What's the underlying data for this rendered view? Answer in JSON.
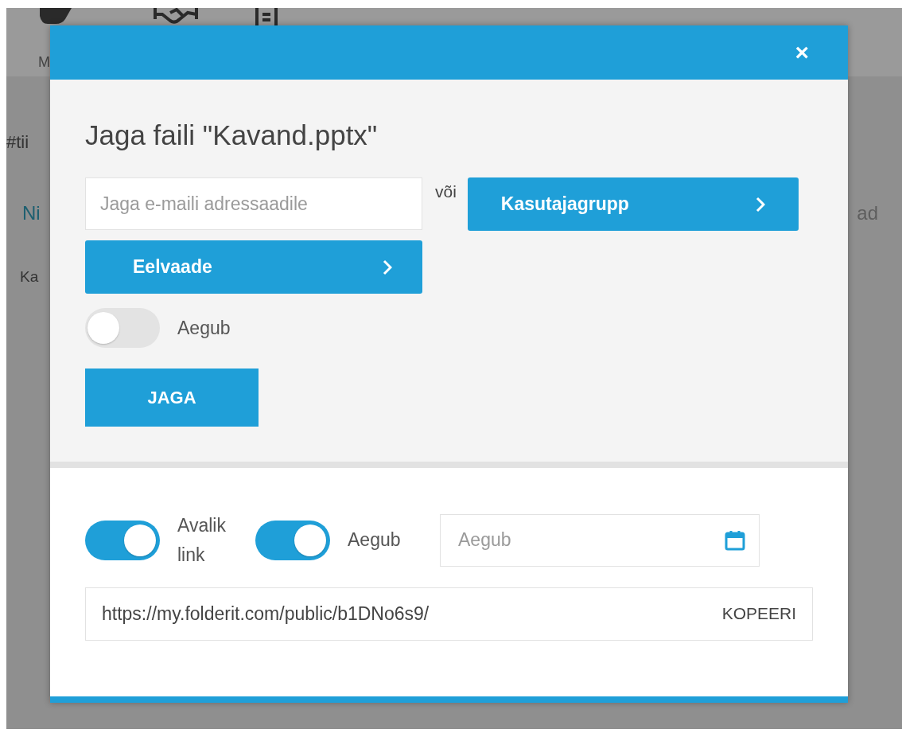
{
  "background": {
    "nav_label": "M",
    "tag": "#tii",
    "heading_left": "Ni",
    "heading_right": "ad",
    "row": "Ka"
  },
  "dialog": {
    "close": "×",
    "title": "Jaga faili \"Kavand.pptx\"",
    "email": {
      "placeholder": "Jaga e-maili adressaadile"
    },
    "or": "või",
    "group_button": "Kasutajagrupp",
    "preview_button": "Eelvaade",
    "expiry_toggle": {
      "label": "Aegub",
      "on": false
    },
    "share_button": "JAGA",
    "link_toggles": [
      {
        "label": "Avalik link",
        "on": true
      },
      {
        "label": "Aegub",
        "on": true
      }
    ],
    "date_field": {
      "placeholder": "Aegub"
    },
    "link": {
      "value": "https://my.folderit.com/public/b1DNo6s9/",
      "copy": "KOPEERI"
    }
  }
}
